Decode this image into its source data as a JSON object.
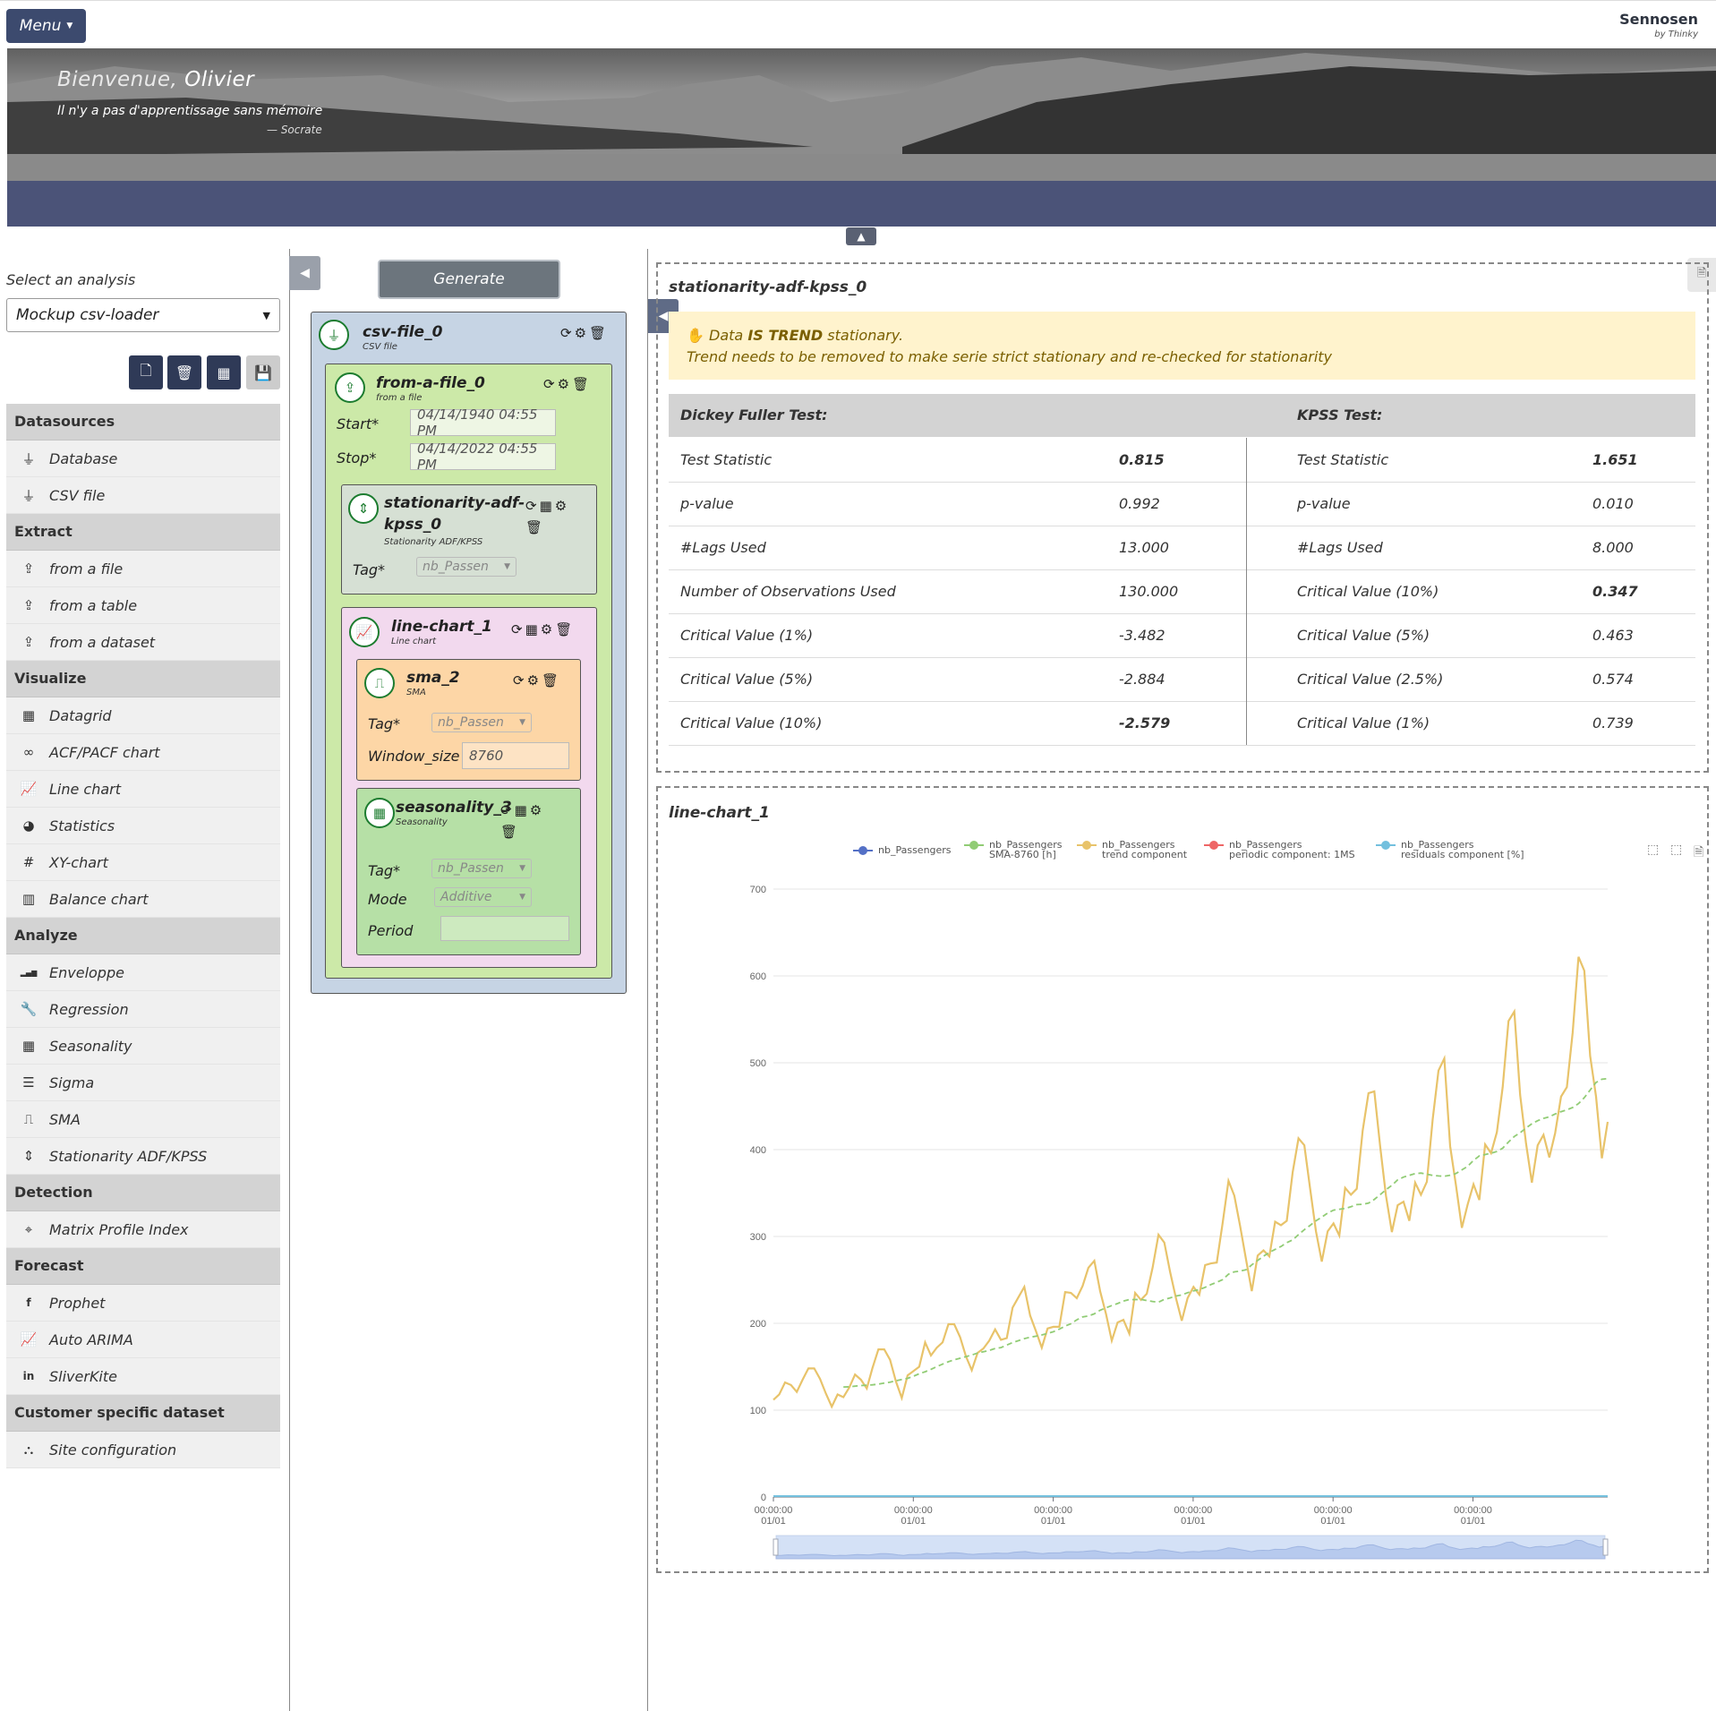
{
  "topbar": {
    "menu_label": "Menu",
    "brand": "Sennosen",
    "brand_sub": "by Thinky"
  },
  "banner": {
    "welcome": "Bienvenue,",
    "user_name": "Olivier",
    "quote": "Il n'y a pas d'apprentissage sans mémoire",
    "quote_author": "— Socrate"
  },
  "sidebar": {
    "select_label": "Select an analysis",
    "selected_analysis": "Mockup csv-loader",
    "sections": [
      {
        "title": "Datasources",
        "items": [
          {
            "label": "Database",
            "icon": "plug-icon"
          },
          {
            "label": "CSV file",
            "icon": "plug-icon"
          }
        ]
      },
      {
        "title": "Extract",
        "items": [
          {
            "label": "from a file",
            "icon": "upload-icon"
          },
          {
            "label": "from a table",
            "icon": "upload-icon"
          },
          {
            "label": "from a dataset",
            "icon": "upload-icon"
          }
        ]
      },
      {
        "title": "Visualize",
        "items": [
          {
            "label": "Datagrid",
            "icon": "table-icon"
          },
          {
            "label": "ACF/PACF chart",
            "icon": "infinity-icon"
          },
          {
            "label": "Line chart",
            "icon": "line-chart-icon"
          },
          {
            "label": "Statistics",
            "icon": "pie-chart-icon"
          },
          {
            "label": "XY-chart",
            "icon": "hashtag-icon"
          },
          {
            "label": "Balance chart",
            "icon": "bar-chart-icon"
          }
        ]
      },
      {
        "title": "Analyze",
        "items": [
          {
            "label": "Enveloppe",
            "icon": "signal-icon"
          },
          {
            "label": "Regression",
            "icon": "wrench-icon"
          },
          {
            "label": "Seasonality",
            "icon": "calendar-icon"
          },
          {
            "label": "Sigma",
            "icon": "indent-icon"
          },
          {
            "label": "SMA",
            "icon": "wave-square-icon"
          },
          {
            "label": "Stationarity ADF/KPSS",
            "icon": "sort-icon"
          }
        ]
      },
      {
        "title": "Detection",
        "items": [
          {
            "label": "Matrix Profile Index",
            "icon": "crosshair-icon"
          }
        ]
      },
      {
        "title": "Forecast",
        "items": [
          {
            "label": "Prophet",
            "icon": "facebook-icon"
          },
          {
            "label": "Auto ARIMA",
            "icon": "line-chart-icon"
          },
          {
            "label": "SliverKite",
            "icon": "linkedin-icon"
          }
        ]
      },
      {
        "title": "Customer specific dataset",
        "items": [
          {
            "label": "Site configuration",
            "icon": "sitemap-icon"
          }
        ]
      }
    ]
  },
  "pipeline": {
    "generate_label": "Generate",
    "csv": {
      "title": "csv-file_0",
      "subtitle": "CSV file"
    },
    "from_file": {
      "title": "from-a-file_0",
      "subtitle": "from a file",
      "start_label": "Start*",
      "start_value": "04/14/1940 04:55 PM",
      "stop_label": "Stop*",
      "stop_value": "04/14/2022 04:55 PM"
    },
    "stationarity": {
      "title_1": "stationarity-adf-",
      "title_2": "kpss_0",
      "subtitle": "Stationarity ADF/KPSS",
      "tag_label": "Tag*",
      "tag_value": "nb_Passen"
    },
    "line_chart": {
      "title": "line-chart_1",
      "subtitle": "Line chart"
    },
    "sma": {
      "title": "sma_2",
      "subtitle": "SMA",
      "tag_label": "Tag*",
      "tag_value": "nb_Passen",
      "window_label": "Window_size",
      "window_value": "8760"
    },
    "seasonality": {
      "title": "seasonality_3",
      "subtitle": "Seasonality",
      "tag_label": "Tag*",
      "tag_value": "nb_Passen",
      "mode_label": "Mode",
      "mode_value": "Additive",
      "period_label": "Period",
      "period_value": ""
    }
  },
  "stationarity_panel": {
    "title": "stationarity-adf-kpss_0",
    "alert_prefix": "Data ",
    "alert_bold": "IS TREND",
    "alert_suffix": " stationary.",
    "alert_line2": "Trend needs to be removed to make serie strict stationary and re-checked for stationarity",
    "adf_header": "Dickey Fuller Test:",
    "kpss_header": "KPSS Test:",
    "rows": [
      {
        "adf_label": "Test Statistic",
        "adf_value": "0.815",
        "adf_bold": true,
        "kpss_label": "Test Statistic",
        "kpss_value": "1.651",
        "kpss_bold": true
      },
      {
        "adf_label": "p-value",
        "adf_value": "0.992",
        "adf_bold": false,
        "kpss_label": "p-value",
        "kpss_value": "0.010",
        "kpss_bold": false
      },
      {
        "adf_label": "#Lags Used",
        "adf_value": "13.000",
        "adf_bold": false,
        "kpss_label": "#Lags Used",
        "kpss_value": "8.000",
        "kpss_bold": false
      },
      {
        "adf_label": "Number of Observations Used",
        "adf_value": "130.000",
        "adf_bold": false,
        "kpss_label": "Critical Value (10%)",
        "kpss_value": "0.347",
        "kpss_bold": true
      },
      {
        "adf_label": "Critical Value (1%)",
        "adf_value": "-3.482",
        "adf_bold": false,
        "kpss_label": "Critical Value (5%)",
        "kpss_value": "0.463",
        "kpss_bold": false
      },
      {
        "adf_label": "Critical Value (5%)",
        "adf_value": "-2.884",
        "adf_bold": false,
        "kpss_label": "Critical Value (2.5%)",
        "kpss_value": "0.574",
        "kpss_bold": false
      },
      {
        "adf_label": "Critical Value (10%)",
        "adf_value": "-2.579",
        "adf_bold": true,
        "kpss_label": "Critical Value (1%)",
        "kpss_value": "0.739",
        "kpss_bold": false
      }
    ]
  },
  "chart_panel": {
    "title": "line-chart_1"
  },
  "chart_data": {
    "type": "line",
    "ylim": [
      0,
      700
    ],
    "yticks": [
      0,
      100,
      200,
      300,
      400,
      500,
      600,
      700
    ],
    "xtick_labels": [
      [
        "00:00:00",
        "01/01"
      ],
      [
        "00:00:00",
        "01/01"
      ],
      [
        "00:00:00",
        "01/01"
      ],
      [
        "00:00:00",
        "01/01"
      ],
      [
        "00:00:00",
        "01/01"
      ],
      [
        "00:00:00",
        "01/01"
      ]
    ],
    "grid": true,
    "legend_position": "top",
    "series": [
      {
        "name": "nb_Passengers",
        "name2": "",
        "color": "#5470c6",
        "values": []
      },
      {
        "name": "nb_Passengers",
        "name2": "SMA-8760 [h]",
        "color": "#91cc75",
        "dashed": true,
        "values": [
          126.7,
          126.9,
          127.6,
          128.3,
          128.8,
          129.2,
          130.0,
          131.1,
          132.3,
          133.8,
          135.3,
          136.6,
          139.1,
          142.0,
          144.2,
          147.0,
          150.1,
          153.0,
          155.8,
          158.0,
          159.8,
          161.7,
          163.5,
          165.8,
          167.3,
          168.8,
          171.0,
          172.1,
          175.0,
          177.8,
          180.0,
          182.4,
          184.0,
          185.2,
          186.6,
          188.3,
          190.3,
          193.3,
          196.8,
          199.6,
          204.0,
          207.3,
          208.5,
          210.9,
          215.0,
          217.8,
          220.4,
          222.8,
          225.7,
          227.3,
          227.3,
          227.5,
          226.2,
          225.2,
          224.3,
          227.5,
          229.3,
          231.4,
          232.7,
          235.3,
          237.3,
          238.9,
          241.4,
          244.6,
          247.2,
          250.3,
          256.6,
          259.3,
          260.1,
          261.6,
          267.3,
          272.4,
          277.2,
          281.6,
          285.2,
          288.5,
          292.9,
          296.0,
          302.2,
          307.8,
          312.8,
          318.0,
          322.3,
          326.9,
          330.3,
          331.3,
          332.3,
          334.2,
          336.7,
          337.0,
          338.4,
          342.7,
          348.1,
          353.8,
          358.9,
          365.3,
          368.3,
          370.4,
          372.4,
          373.0,
          371.8,
          370.3,
          369.7,
          369.4,
          370.5,
          372.5,
          376.7,
          380.7,
          387.6,
          392.8,
          394.3,
          395.9,
          397.8,
          401.7,
          408.8,
          415.2,
          419.4,
          424.8,
          429.8,
          433.3,
          436.0,
          437.7,
          441.0,
          443.7,
          445.8,
          448.6,
          453.0,
          459.9,
          468.6,
          477.3,
          481.0,
          481.8
        ]
      },
      {
        "name": "nb_Passengers",
        "name2": "trend component",
        "color": "#e8c36a",
        "values": [
          112,
          118,
          132,
          129,
          121,
          135,
          148,
          148,
          136,
          119,
          104,
          118,
          115,
          126,
          141,
          135,
          125,
          149,
          170,
          170,
          158,
          133,
          114,
          140,
          145,
          150,
          178,
          163,
          172,
          178,
          199,
          199,
          184,
          162,
          146,
          166,
          171,
          180,
          193,
          181,
          183,
          218,
          230,
          242,
          209,
          191,
          172,
          194,
          196,
          196,
          236,
          235,
          229,
          243,
          264,
          272,
          237,
          211,
          180,
          201,
          204,
          188,
          235,
          227,
          234,
          264,
          302,
          293,
          259,
          229,
          203,
          229,
          242,
          233,
          267,
          269,
          270,
          315,
          364,
          347,
          312,
          274,
          237,
          278,
          284,
          277,
          317,
          313,
          318,
          374,
          413,
          405,
          355,
          306,
          271,
          306,
          315,
          301,
          356,
          348,
          355,
          422,
          465,
          467,
          404,
          347,
          305,
          336,
          340,
          318,
          362,
          348,
          363,
          435,
          491,
          505,
          404,
          359,
          310,
          337,
          360,
          342,
          406,
          396,
          420,
          472,
          548,
          559,
          463,
          407,
          362,
          405,
          417,
          391,
          419,
          461,
          472,
          535,
          622,
          606,
          508,
          461,
          390,
          432
        ]
      },
      {
        "name": "nb_Passengers",
        "name2": "periodic component: 1MS",
        "color": "#ee6666",
        "values": []
      },
      {
        "name": "nb_Passengers",
        "name2": "residuals component [%]",
        "color": "#73c0de",
        "values": []
      }
    ]
  }
}
